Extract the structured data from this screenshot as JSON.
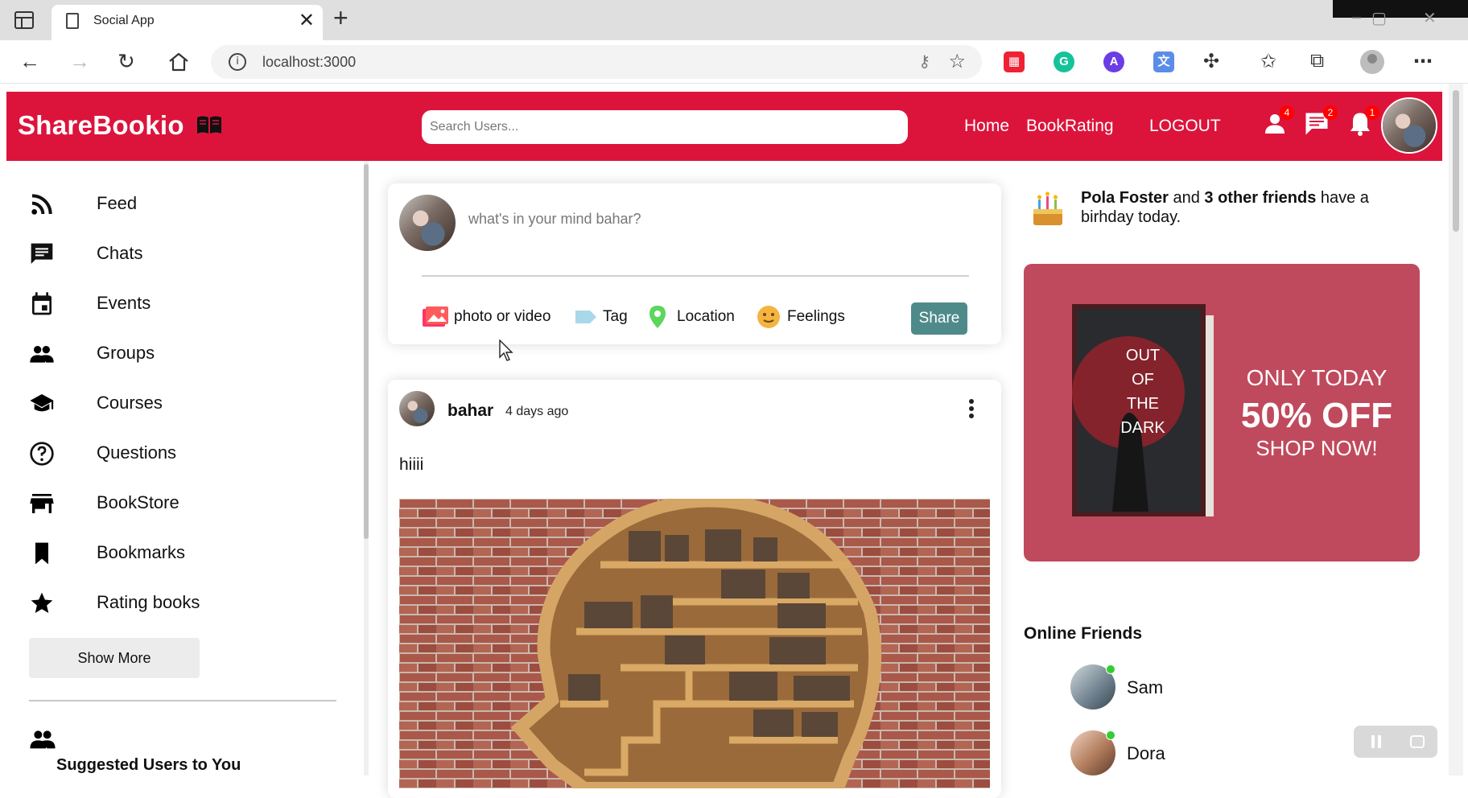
{
  "browser": {
    "tab_title": "Social App",
    "tab_close": "✕",
    "new_tab": "+",
    "url": "localhost:3000",
    "window_controls": [
      "–",
      "▢",
      "✕"
    ]
  },
  "header": {
    "logo": "ShareBookio",
    "search_placeholder": "Search Users...",
    "nav": [
      "Home",
      "BookRating",
      "LOGOUT"
    ],
    "badges": {
      "friend_requests": "4",
      "messages": "2",
      "notifications": "1"
    },
    "brand_color": "#dc143c"
  },
  "sidebar": {
    "items": [
      {
        "label": "Feed",
        "icon": "rss-icon"
      },
      {
        "label": "Chats",
        "icon": "chat-icon"
      },
      {
        "label": "Events",
        "icon": "calendar-icon"
      },
      {
        "label": "Groups",
        "icon": "group-icon"
      },
      {
        "label": "Courses",
        "icon": "school-icon"
      },
      {
        "label": "Questions",
        "icon": "question-icon"
      },
      {
        "label": "BookStore",
        "icon": "store-icon"
      },
      {
        "label": "Bookmarks",
        "icon": "bookmark-icon"
      },
      {
        "label": "Rating books",
        "icon": "star-icon"
      }
    ],
    "show_more": "Show More",
    "suggested_title": "Suggested Users to You"
  },
  "share": {
    "placeholder": "what's in your mind bahar?",
    "options": [
      "photo or video",
      "Tag",
      "Location",
      "Feelings"
    ],
    "share_button": "Share",
    "share_color": "#4f8a8b"
  },
  "post": {
    "username": "bahar",
    "time": "4 days ago",
    "text": "hiiii"
  },
  "birthday": {
    "name": "Pola Foster",
    "connector": " and ",
    "others": "3 other friends",
    "suffix": " have a birhday today."
  },
  "ad": {
    "book_title": [
      "OUT",
      "OF",
      "THE",
      "DARK"
    ],
    "line1": "ONLY TODAY",
    "line2": "50% OFF",
    "line3": "SHOP NOW!",
    "background": "#c04a5d"
  },
  "online": {
    "title": "Online Friends",
    "friends": [
      "Sam",
      "Dora"
    ]
  }
}
